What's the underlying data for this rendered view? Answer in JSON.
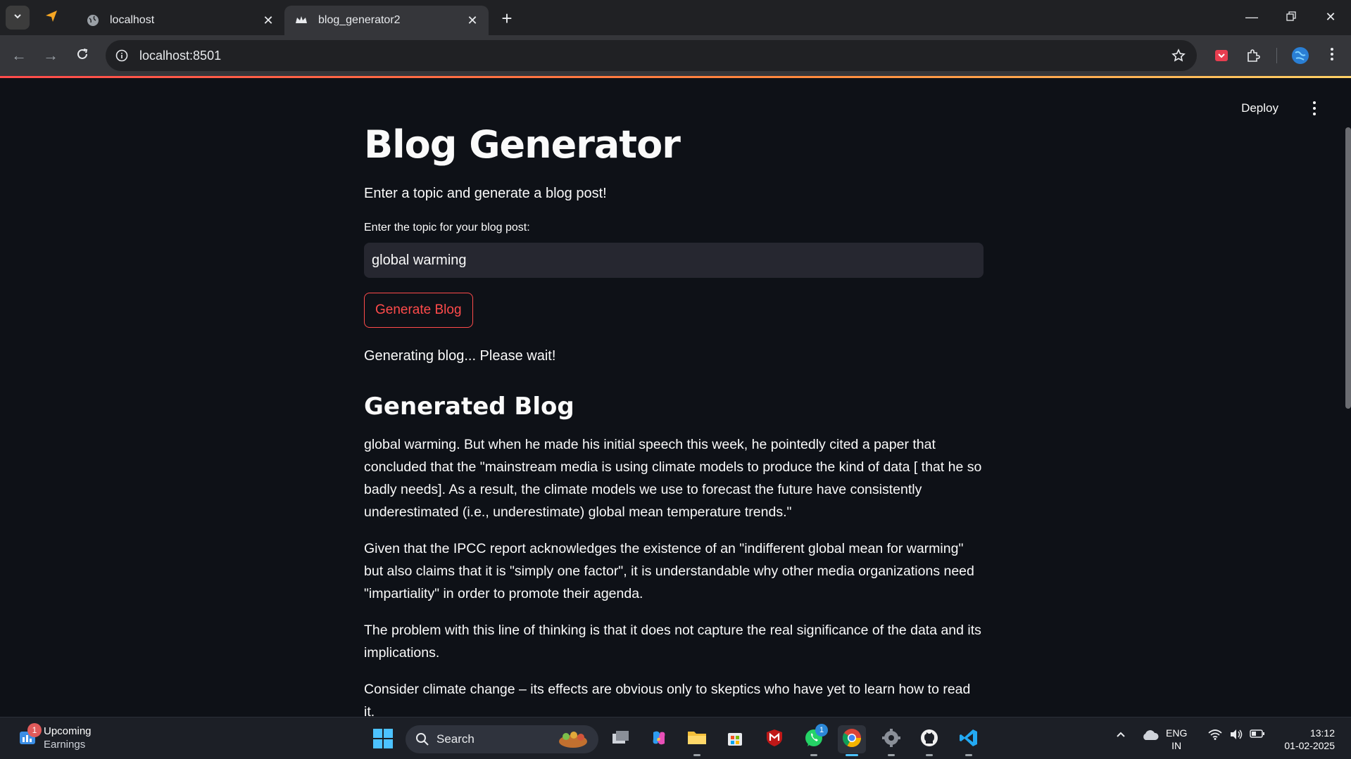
{
  "browser": {
    "tabs": [
      {
        "label": "localhost",
        "active": false
      },
      {
        "label": "blog_generator2",
        "active": true
      }
    ],
    "url": "localhost:8501"
  },
  "app": {
    "deploy_label": "Deploy",
    "title": "Blog Generator",
    "intro": "Enter a topic and generate a blog post!",
    "topic_label": "Enter the topic for your blog post:",
    "topic_value": "global warming",
    "generate_button": "Generate Blog",
    "status": "Generating blog... Please wait!",
    "generated_heading": "Generated Blog",
    "paragraphs": [
      "global warming. But when he made his initial speech this week, he pointedly cited a paper that concluded that the \"mainstream media is using climate models to produce the kind of data [ that he so badly needs]. As a result, the climate models we use to forecast the future have consistently underestimated (i.e., underestimate) global mean temperature trends.\"",
      "Given that the IPCC report acknowledges the existence of an \"indifferent global mean for warming\" but also claims that it is \"simply one factor\", it is understandable why other media organizations need \"impartiality\" in order to promote their agenda.",
      "The problem with this line of thinking is that it does not capture the real significance of the data and its implications.",
      "Consider climate change – its effects are obvious only to skeptics who have yet to learn how to read it."
    ],
    "accent_color": "#ff4b4b"
  },
  "taskbar": {
    "widget_title": "Upcoming",
    "widget_sub": "Earnings",
    "widget_badge": "1",
    "search_label": "Search",
    "whatsapp_badge": "1",
    "lang_line1": "ENG",
    "lang_line2": "IN",
    "time": "13:12",
    "date": "01-02-2025"
  }
}
